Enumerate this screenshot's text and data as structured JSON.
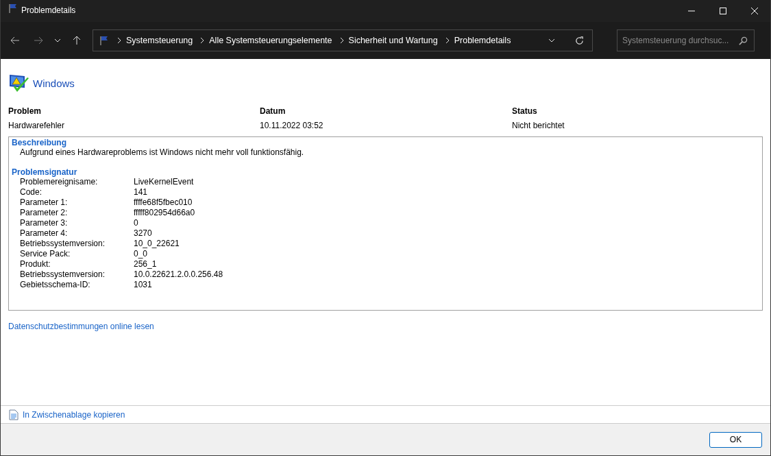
{
  "window": {
    "title": "Problemdetails"
  },
  "address_bar": {
    "breadcrumbs": [
      "Systemsteuerung",
      "Alle Systemsteuerungselemente",
      "Sicherheit und Wartung",
      "Problemdetails"
    ]
  },
  "search": {
    "placeholder": "Systemsteuerung durchsuc..."
  },
  "header": {
    "title": "Windows"
  },
  "summary": [
    {
      "heading": "Problem",
      "value": "Hardwarefehler"
    },
    {
      "heading": "Datum",
      "value": "10.11.2022 03:52"
    },
    {
      "heading": "Status",
      "value": "Nicht berichtet"
    }
  ],
  "description": {
    "heading": "Beschreibung",
    "text": "Aufgrund eines Hardwareproblems ist Windows nicht mehr voll funktionsfähig."
  },
  "signature": {
    "heading": "Problemsignatur",
    "rows": [
      {
        "label": "Problemereignisame:",
        "value": "LiveKernelEvent"
      },
      {
        "label": "Code:",
        "value": "141"
      },
      {
        "label": "Parameter 1:",
        "value": "ffffe68f5fbec010"
      },
      {
        "label": "Parameter 2:",
        "value": "fffff802954d66a0"
      },
      {
        "label": "Parameter 3:",
        "value": "0"
      },
      {
        "label": "Parameter 4:",
        "value": "3270"
      },
      {
        "label": "Betriebssystemversion:",
        "value": "10_0_22621"
      },
      {
        "label": "Service Pack:",
        "value": "0_0"
      },
      {
        "label": "Produkt:",
        "value": "256_1"
      },
      {
        "label": "Betriebssystemversion:",
        "value": "10.0.22621.2.0.0.256.48"
      },
      {
        "label": "Gebietsschema-ID:",
        "value": "1031"
      }
    ]
  },
  "privacy_link": "Datenschutzbestimmungen online lesen",
  "copy_link": "In Zwischenablage kopieren",
  "buttons": [
    "OK"
  ]
}
